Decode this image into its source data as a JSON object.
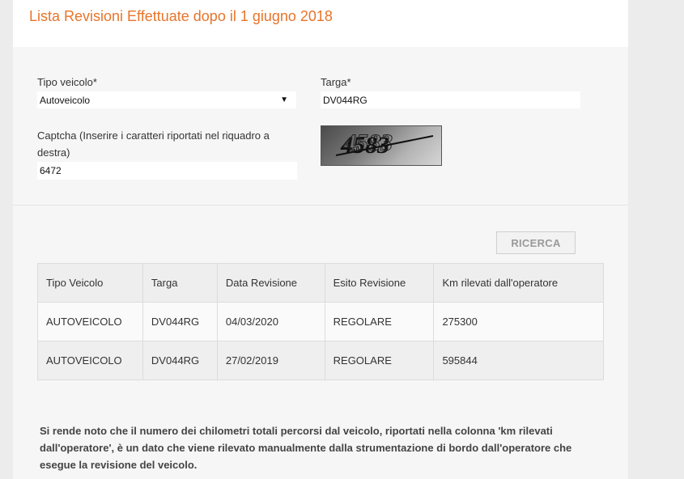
{
  "header": {
    "title": "Lista Revisioni Effettuate dopo il 1 giugno 2018"
  },
  "form": {
    "vehicle_type_label": "Tipo veicolo*",
    "vehicle_type_value": "Autoveicolo",
    "plate_label": "Targa*",
    "plate_value": "DV044RG",
    "captcha_label": "Captcha (Inserire i caratteri riportati nel riquadro a destra)",
    "captcha_value": "6472",
    "captcha_image_text": "4583",
    "search_button": "RICERCA"
  },
  "table": {
    "headers": [
      "Tipo Veicolo",
      "Targa",
      "Data Revisione",
      "Esito Revisione",
      "Km rilevati dall'operatore"
    ],
    "rows": [
      [
        "AUTOVEICOLO",
        "DV044RG",
        "04/03/2020",
        "REGOLARE",
        "275300"
      ],
      [
        "AUTOVEICOLO",
        "DV044RG",
        "27/02/2019",
        "REGOLARE",
        "595844"
      ]
    ]
  },
  "note": "Si rende noto che il numero dei chilometri totali percorsi dal veicolo, riportati nella colonna 'km rilevati dall'operatore', è un dato che viene rilevato manualmente dalla strumentazione di bordo dall'operatore che esegue la revisione del veicolo.",
  "colors": {
    "accent": "#e8742a",
    "panel": "#f6f6f6",
    "background": "#ececec"
  }
}
